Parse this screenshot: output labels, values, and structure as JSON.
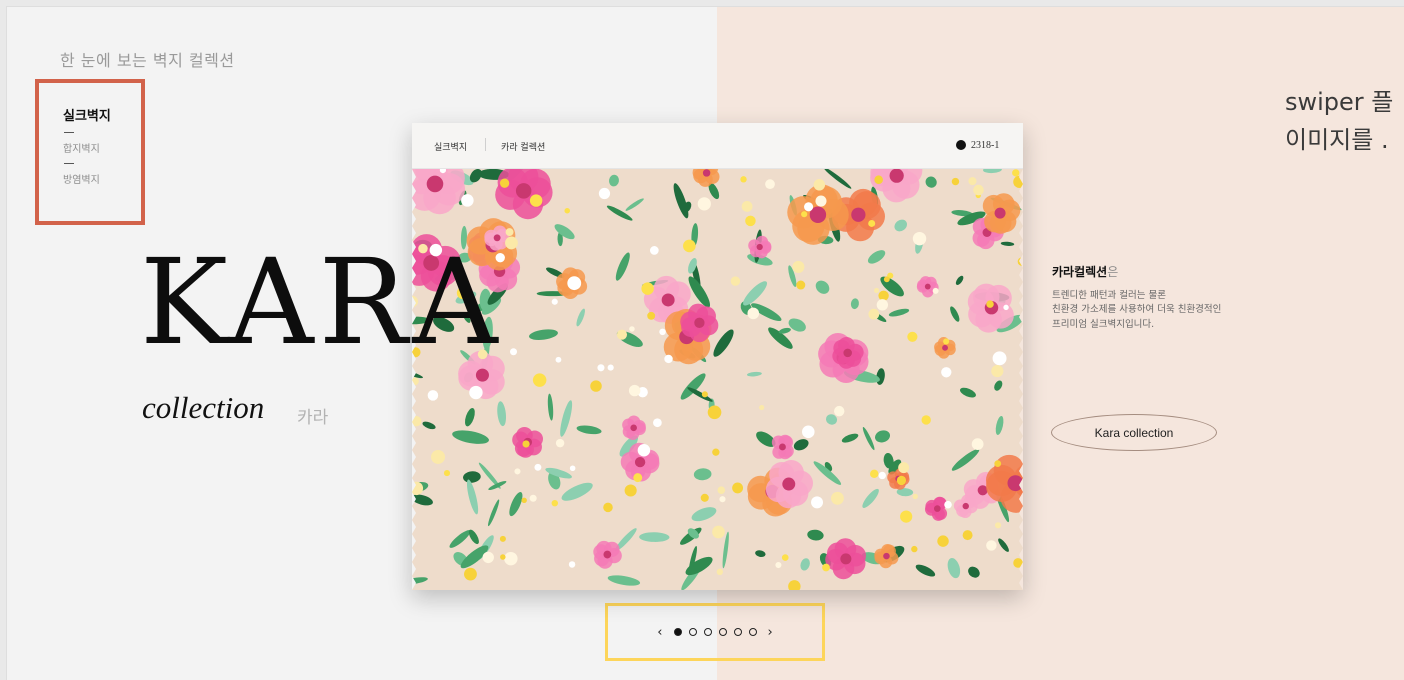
{
  "header": {
    "section_title": "한 눈에 보는 벽지 컬렉션"
  },
  "categories": [
    {
      "label": "실크벽지",
      "active": true
    },
    {
      "label": "합지벽지",
      "active": false
    },
    {
      "label": "방염벽지",
      "active": false
    }
  ],
  "hero": {
    "title": "KARA",
    "subtitle": "collection",
    "subtitle_kr": "카라"
  },
  "card": {
    "category": "실크벽지",
    "collection": "카라 컬렉션",
    "code": "2318-1"
  },
  "description": {
    "title": "카라컬렉션",
    "title_suffix": "은",
    "lines": [
      "트렌디한 패턴과 컬러는 물론",
      "친환경 가소제를 사용하여 더욱 친환경적인",
      "프리미엄 실크벽지입니다."
    ]
  },
  "cta": {
    "label": "Kara collection"
  },
  "note": {
    "line1": "swiper 플",
    "line2": "이미지를 ."
  },
  "pagination": {
    "prev": "‹",
    "next": "›",
    "count": 6,
    "active": 1
  },
  "colors": {
    "left_bg": "#f3f3f3",
    "right_bg": "#f5e6dd",
    "highlight_red": "#d2624a",
    "highlight_yellow": "#fdd55a"
  }
}
